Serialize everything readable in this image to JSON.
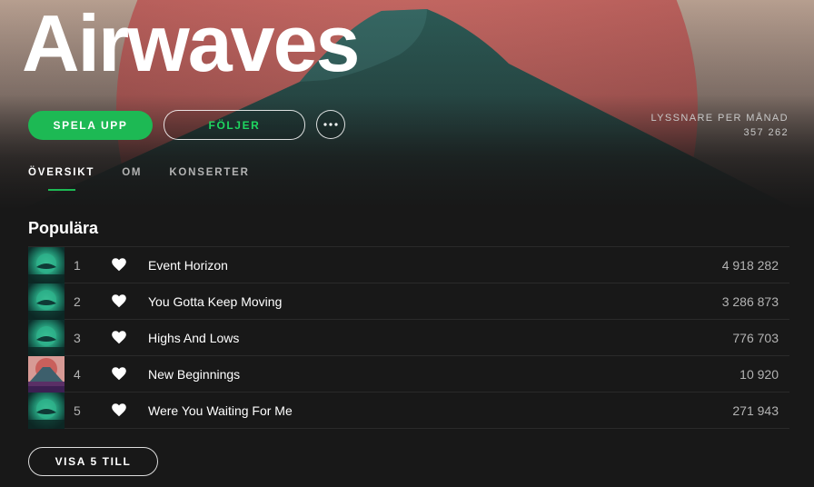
{
  "artist": {
    "name": "Airwaves"
  },
  "actions": {
    "play_label": "SPELA UPP",
    "follow_label": "FÖLJER",
    "more_icon": "more-horizontal-icon"
  },
  "listeners": {
    "label": "LYSSNARE PER MÅNAD",
    "value": "357 262"
  },
  "tabs": [
    {
      "label": "ÖVERSIKT",
      "active": true
    },
    {
      "label": "OM",
      "active": false
    },
    {
      "label": "KONSERTER",
      "active": false
    }
  ],
  "popular": {
    "title": "Populära",
    "tracks": [
      {
        "number": "1",
        "title": "Event Horizon",
        "plays": "4 918 282",
        "cover": "teal"
      },
      {
        "number": "2",
        "title": "You Gotta Keep Moving",
        "plays": "3 286 873",
        "cover": "teal"
      },
      {
        "number": "3",
        "title": "Highs And Lows",
        "plays": "776 703",
        "cover": "teal"
      },
      {
        "number": "4",
        "title": "New Beginnings",
        "plays": "10 920",
        "cover": "mountain"
      },
      {
        "number": "5",
        "title": "Were You Waiting For Me",
        "plays": "271 943",
        "cover": "teal"
      }
    ],
    "show_more_label": "VISA 5 TILL"
  },
  "colors": {
    "accent": "#1db954",
    "background": "#181818",
    "divider": "#2a2a2a"
  }
}
